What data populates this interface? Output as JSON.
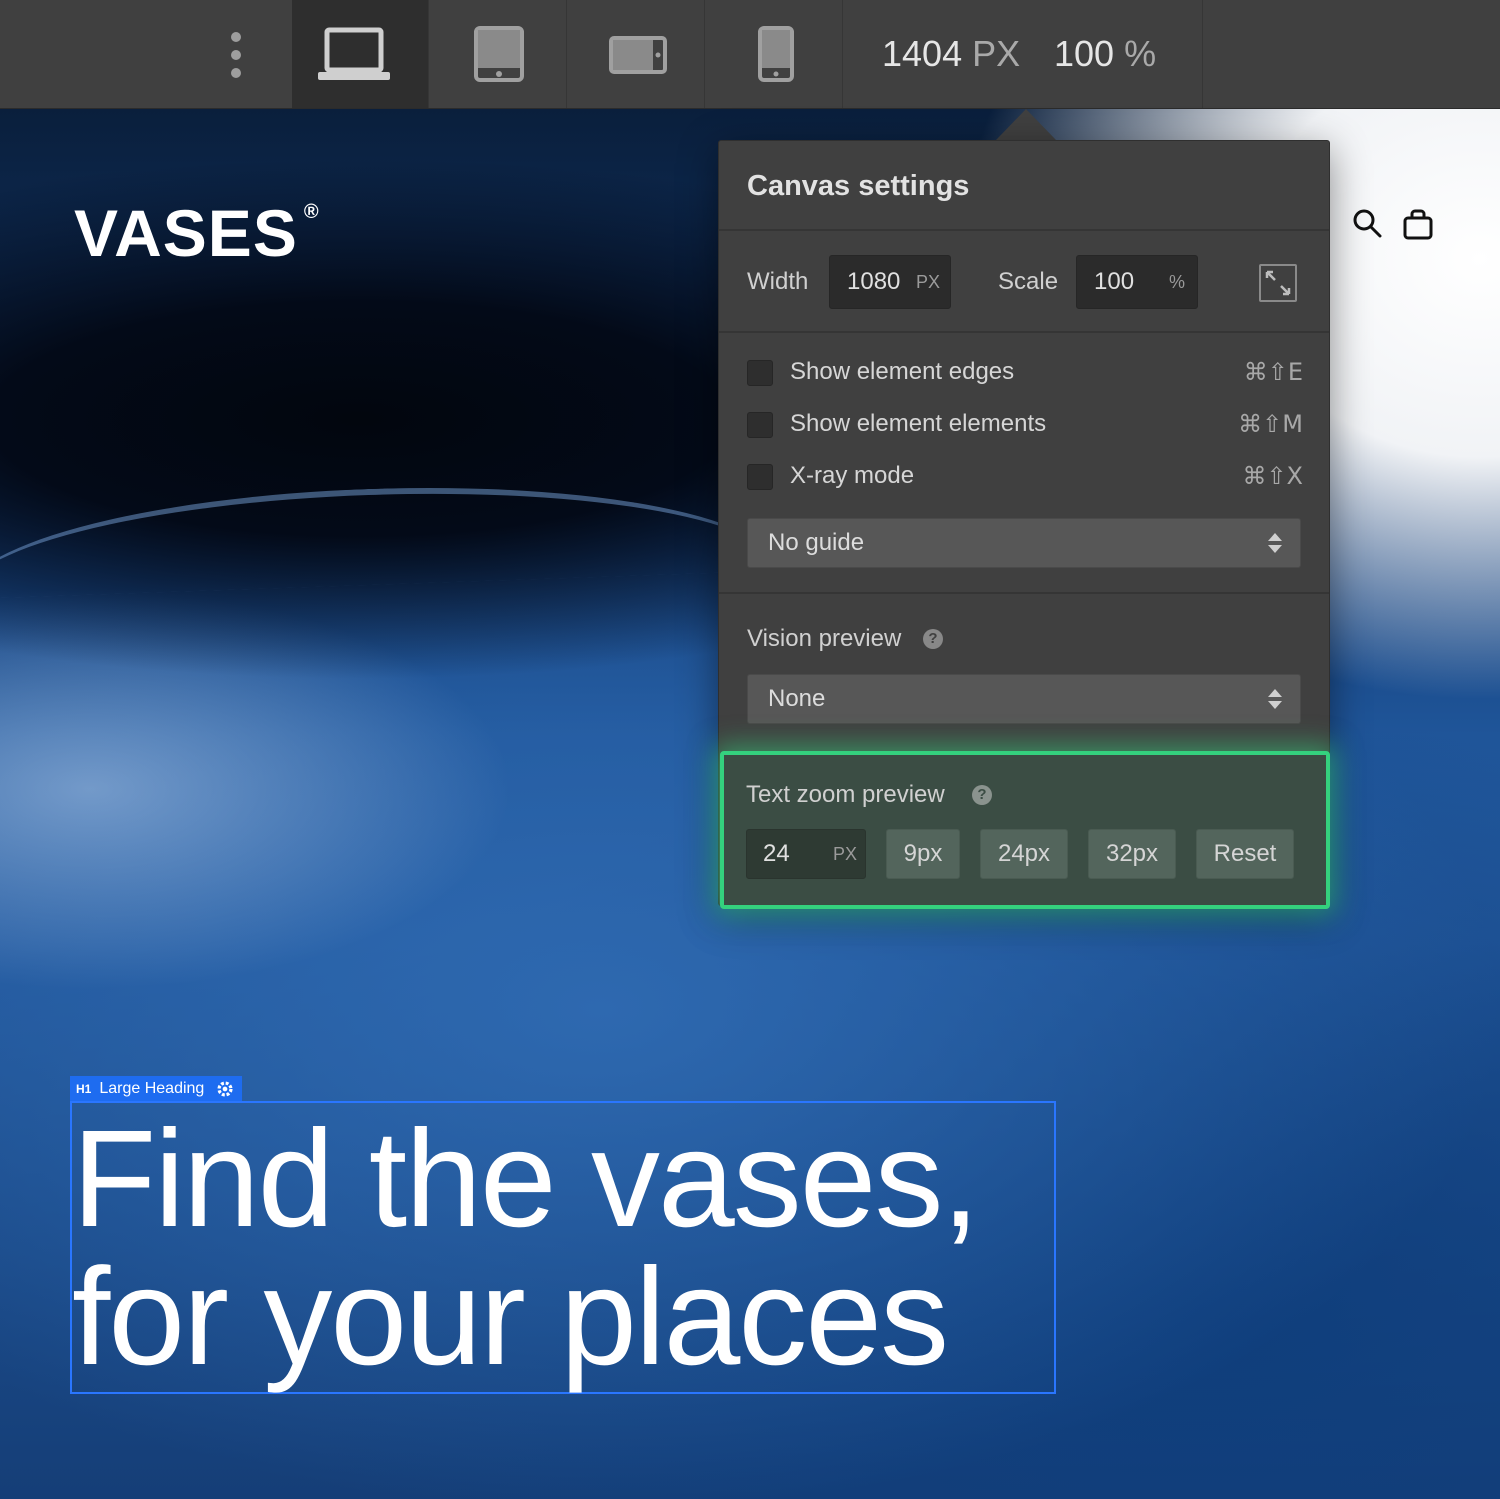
{
  "toolbar": {
    "devices": [
      {
        "name": "desktop",
        "active": true
      },
      {
        "name": "tablet",
        "active": false
      },
      {
        "name": "mobile-landscape",
        "active": false
      },
      {
        "name": "mobile-portrait",
        "active": false
      }
    ],
    "canvas_width": "1404",
    "canvas_width_unit": "PX",
    "zoom": "100",
    "zoom_unit": "%"
  },
  "site": {
    "brand": "VASES",
    "brand_mark": "®",
    "heading_tag": "H1",
    "heading_label": "Large Heading",
    "heading_lines": [
      "Find the vases,",
      "for your places"
    ]
  },
  "panel": {
    "title": "Canvas settings",
    "width_label": "Width",
    "width_value": "1080",
    "width_unit": "PX",
    "scale_label": "Scale",
    "scale_value": "100",
    "scale_unit": "%",
    "options": [
      {
        "label": "Show element edges",
        "shortcut": "⌘⇧E",
        "checked": false
      },
      {
        "label": "Show element elements",
        "shortcut": "⌘⇧M",
        "checked": false
      },
      {
        "label": "X-ray mode",
        "shortcut": "⌘⇧X",
        "checked": false
      }
    ],
    "guide_value": "No guide",
    "vision_label": "Vision preview",
    "vision_value": "None",
    "text_zoom_label": "Text zoom preview",
    "text_zoom_value": "24",
    "text_zoom_unit": "PX",
    "text_zoom_presets": [
      "9px",
      "24px",
      "32px"
    ],
    "reset_label": "Reset"
  },
  "colors": {
    "toolbar": "#404040",
    "panel": "#404040",
    "selection": "#1e6cf0",
    "highlight": "#34d17e"
  }
}
